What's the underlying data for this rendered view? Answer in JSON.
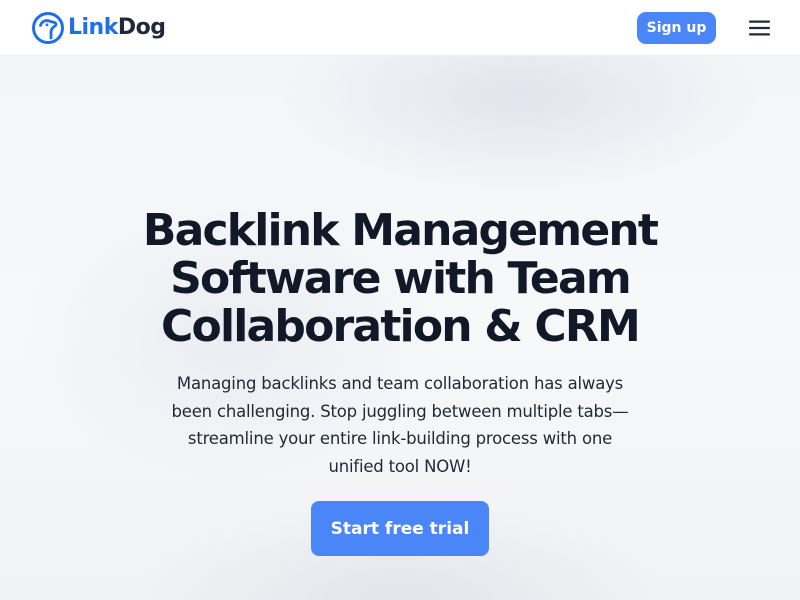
{
  "brand": {
    "name_part1": "Link",
    "name_part2": "Dog",
    "logo_icon": "dog-head-circle-icon",
    "colors": {
      "link": "#1f6feb",
      "dog": "#1f2937"
    }
  },
  "nav": {
    "signup_label": "Sign up",
    "menu_icon": "hamburger-menu-icon"
  },
  "hero": {
    "headline": "Backlink Management Software with Team Collaboration & CRM",
    "subtext": "Managing backlinks and team collaboration has always been challenging. Stop juggling between multiple tabs—streamline your entire link-building process with one unified tool NOW!",
    "cta_label": "Start free trial"
  },
  "colors": {
    "accent": "#4a86f7",
    "text": "#111827"
  }
}
